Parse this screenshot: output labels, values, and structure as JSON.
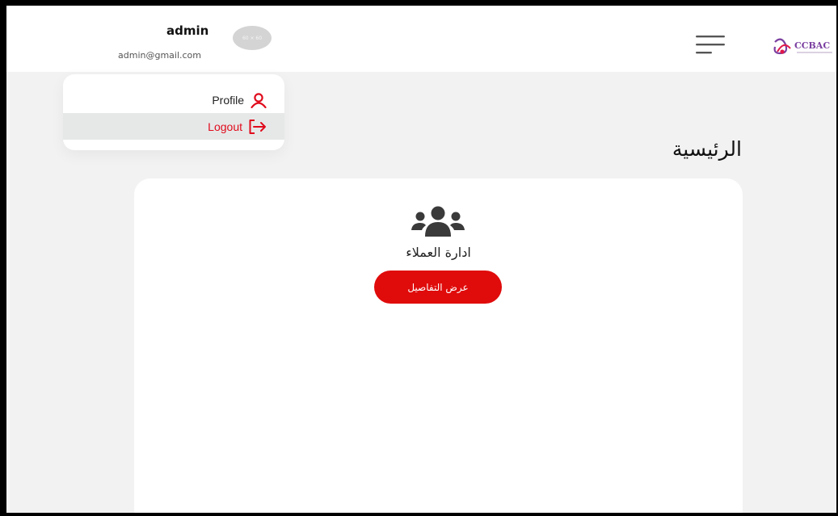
{
  "user": {
    "name": "admin",
    "email": "admin@gmail.com",
    "avatar_text": "60 × 60"
  },
  "dropdown": {
    "profile_label": "Profile",
    "logout_label": "Logout"
  },
  "page": {
    "title": "الرئيسية"
  },
  "card": {
    "title": "ادارة العملاء",
    "button_label": "عرض التفاصيل"
  },
  "logo": {
    "text": "CCBAC"
  },
  "colors": {
    "accent": "#e00b0b",
    "background": "#f2f2f2",
    "menu_highlight": "#e6e8e8"
  },
  "icons": {
    "menu": "hamburger-menu-icon",
    "profile": "user-icon",
    "logout": "logout-icon",
    "users": "users-group-icon"
  }
}
